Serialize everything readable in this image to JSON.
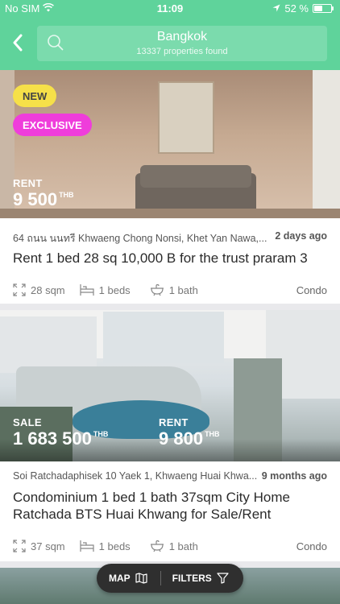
{
  "status": {
    "carrier": "No SIM",
    "time": "11:09",
    "battery_pct": "52 %",
    "battery_level": 0.52
  },
  "search": {
    "title": "Bangkok",
    "subtitle": "13337 properties found"
  },
  "listings": [
    {
      "badges": [
        "NEW",
        "EXCLUSIVE"
      ],
      "prices": [
        {
          "label": "RENT",
          "value": "9 500",
          "currency": "THB"
        }
      ],
      "address": "64 ถนน นนทรี Khwaeng Chong Nonsi, Khet Yan Nawa,...",
      "ago": "2 days ago",
      "title": "Rent 1 bed 28 sq 10,000 B for the trust praram 3",
      "area": "28 sqm",
      "beds": "1 beds",
      "baths": "1 bath",
      "type": "Condo"
    },
    {
      "badges": [],
      "prices": [
        {
          "label": "SALE",
          "value": "1 683 500",
          "currency": "THB"
        },
        {
          "label": "RENT",
          "value": "9 800",
          "currency": "THB"
        }
      ],
      "address": "Soi Ratchadaphisek 10 Yaek 1, Khwaeng Huai Khwa...",
      "ago": "9 months ago",
      "title_line1": "Condominium 1 bed 1 bath 37sqm City Home",
      "title_line2": "Ratchada BTS Huai Khwang for Sale/Rent",
      "area": "37 sqm",
      "beds": "1 beds",
      "baths": "1 bath",
      "type": "Condo"
    }
  ],
  "bottom_bar": {
    "map_label": "MAP",
    "filters_label": "FILTERS"
  },
  "icons": [
    "wifi-icon",
    "location-arrow-icon",
    "battery-icon",
    "back-chevron-icon",
    "search-icon",
    "area-icon",
    "bed-icon",
    "bath-icon",
    "map-icon",
    "filter-icon"
  ],
  "colors": {
    "header": "#5fd39b",
    "badge_new": "#f6e049",
    "badge_exclusive": "#ef3ddb",
    "bottom_bar": "#2f2f2f"
  }
}
